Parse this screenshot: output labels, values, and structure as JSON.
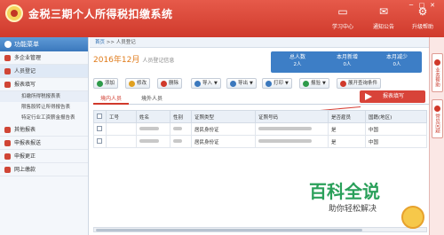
{
  "header": {
    "title": "金税三期个人所得税扣缴系统",
    "buttons": [
      {
        "label": "学习中心",
        "icon": "monitor-icon"
      },
      {
        "label": "通知公告",
        "icon": "envelope-icon"
      },
      {
        "label": "升级帮助",
        "icon": "gear-icon"
      }
    ],
    "window_controls": [
      "─",
      "□",
      "✕"
    ]
  },
  "sidebar": {
    "title": "功能菜单",
    "items": [
      {
        "label": "多企业管理"
      },
      {
        "label": "人员登记",
        "active": true
      },
      {
        "label": "报表填写"
      },
      {
        "label": "其他报表"
      },
      {
        "label": "申报表报送"
      },
      {
        "label": "申报更正"
      },
      {
        "label": "网上缴款"
      }
    ],
    "subitems": [
      {
        "label": "扣缴所得税报表表"
      },
      {
        "label": "限售股转让所得报告表"
      },
      {
        "label": "特定行业工资薪金报告表"
      }
    ]
  },
  "breadcrumb": {
    "home": "首页",
    "separator": ">>",
    "current": "人员登记"
  },
  "period": {
    "value": "2016年12月",
    "suffix": "人员登记信息"
  },
  "stats": [
    {
      "label": "总人数",
      "value": "2人"
    },
    {
      "label": "本月新增",
      "value": "0人"
    },
    {
      "label": "本月减少",
      "value": "0人"
    }
  ],
  "toolbar": {
    "buttons": [
      {
        "label": "添加",
        "icon": "add-icon",
        "color": "#2e9a4a"
      },
      {
        "label": "修改",
        "icon": "edit-icon",
        "color": "#e0a020"
      },
      {
        "label": "删除",
        "icon": "delete-icon",
        "color": "#d0392b"
      },
      {
        "label": "导入",
        "icon": "import-icon",
        "color": "#3b78bd",
        "dropdown": true
      },
      {
        "label": "导出",
        "icon": "export-icon",
        "color": "#3b78bd",
        "dropdown": true
      },
      {
        "label": "打印",
        "icon": "print-icon",
        "color": "#3b78bd",
        "dropdown": true
      },
      {
        "label": "报验",
        "icon": "verify-icon",
        "color": "#2e9a4a",
        "dropdown": true
      },
      {
        "label": "展开查询条件",
        "icon": "plus-icon",
        "color": "#d0392b"
      }
    ]
  },
  "tabs": [
    {
      "label": "境内人员",
      "active": true
    },
    {
      "label": "境外人员",
      "active": false
    }
  ],
  "report_button": {
    "label": "报表填写"
  },
  "table": {
    "columns": [
      "",
      "工号",
      "姓名",
      "性别",
      "证照类型",
      "证照号码",
      "是否雇员",
      "国籍(地区)"
    ],
    "rows": [
      {
        "id_type": "居民身份证",
        "is_employee": "是",
        "nationality": "中国"
      },
      {
        "id_type": "居民身份证",
        "is_employee": "是",
        "nationality": "中国"
      }
    ]
  },
  "right_panel": [
    {
      "label": "业务帮助"
    },
    {
      "label": "常见问题"
    }
  ],
  "watermark": {
    "title": "百科全说",
    "subtitle": "助你轻松解决"
  }
}
